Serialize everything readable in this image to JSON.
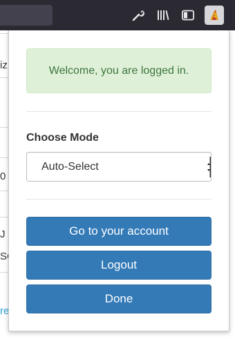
{
  "toolbar": {
    "icons": [
      "wrench-icon",
      "library-icon",
      "sidebar-icon",
      "extension-icon"
    ]
  },
  "background_page": {
    "fragments": [
      "iz",
      "0",
      "J",
      "SC",
      "re"
    ]
  },
  "popup": {
    "welcome_message": "Welcome, you are logged in.",
    "mode_label": "Choose Mode",
    "mode_selected": "Auto-Select",
    "buttons": {
      "account": "Go to your account",
      "logout": "Logout",
      "done": "Done"
    }
  },
  "colors": {
    "primary_button": "#337ab7",
    "success_bg": "#dff0d8",
    "success_text": "#3c763d",
    "toolbar_bg": "#2b2a33"
  }
}
